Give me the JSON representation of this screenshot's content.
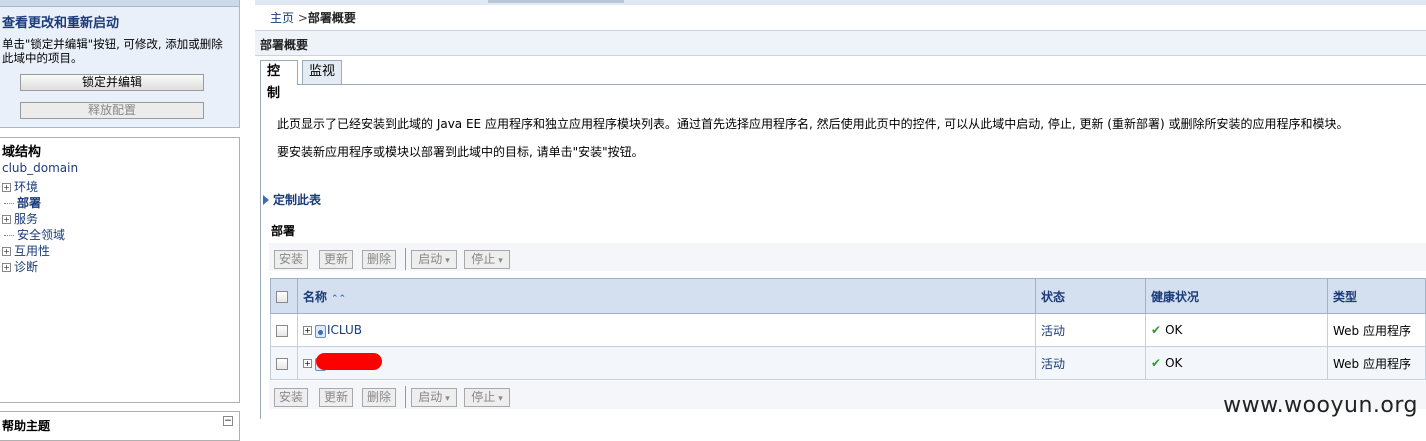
{
  "change_center": {
    "title": "查看更改和重新启动",
    "description": "单击\"锁定并编辑\"按钮, 可修改, 添加或删除此域中的项目。",
    "lock_button": "锁定并编辑",
    "release_button": "释放配置"
  },
  "domain_structure": {
    "title": "域结构",
    "root": "club_domain",
    "items": [
      {
        "label": "环境",
        "expandable": true
      },
      {
        "label": "部署",
        "expandable": false,
        "selected": true
      },
      {
        "label": "服务",
        "expandable": true
      },
      {
        "label": "安全领域",
        "expandable": false
      },
      {
        "label": "互用性",
        "expandable": true
      },
      {
        "label": "诊断",
        "expandable": true
      }
    ]
  },
  "help": {
    "title": "帮助主题",
    "collapse_icon": "minus-icon"
  },
  "breadcrumb": {
    "home": "主页",
    "sep": " >",
    "current": "部署概要"
  },
  "page_title": "部署概要",
  "tabs": [
    {
      "label": "控制",
      "active": true
    },
    {
      "label": "监视",
      "active": false
    }
  ],
  "description": {
    "line1": "此页显示了已经安装到此域的 Java EE 应用程序和独立应用程序模块列表。通过首先选择应用程序名, 然后使用此页中的控件, 可以从此域中启动, 停止, 更新 (重新部署) 或删除所安装的应用程序和模块。",
    "line2": "要安装新应用程序或模块以部署到此域中的目标, 请单击\"安装\"按钮。"
  },
  "customize_link": "定制此表",
  "section_title": "部署",
  "toolbar": {
    "install": "安装",
    "update": "更新",
    "delete": "删除",
    "start": "启动",
    "stop": "停止"
  },
  "table": {
    "headers": {
      "name": "名称",
      "status": "状态",
      "health": "健康状况",
      "type": "类型"
    },
    "rows": [
      {
        "name": "ICLUB",
        "status": "活动",
        "health": "OK",
        "type": "Web 应用程序",
        "redacted": false
      },
      {
        "name": "",
        "status": "活动",
        "health": "OK",
        "type": "Web 应用程序",
        "redacted": true
      }
    ]
  },
  "colors": {
    "accent": "#1b3b7a",
    "header_bg": "#d4e0ef",
    "ok_green": "#2e9a2e",
    "redaction": "#ff0000"
  },
  "watermark": "www.wooyun.org"
}
